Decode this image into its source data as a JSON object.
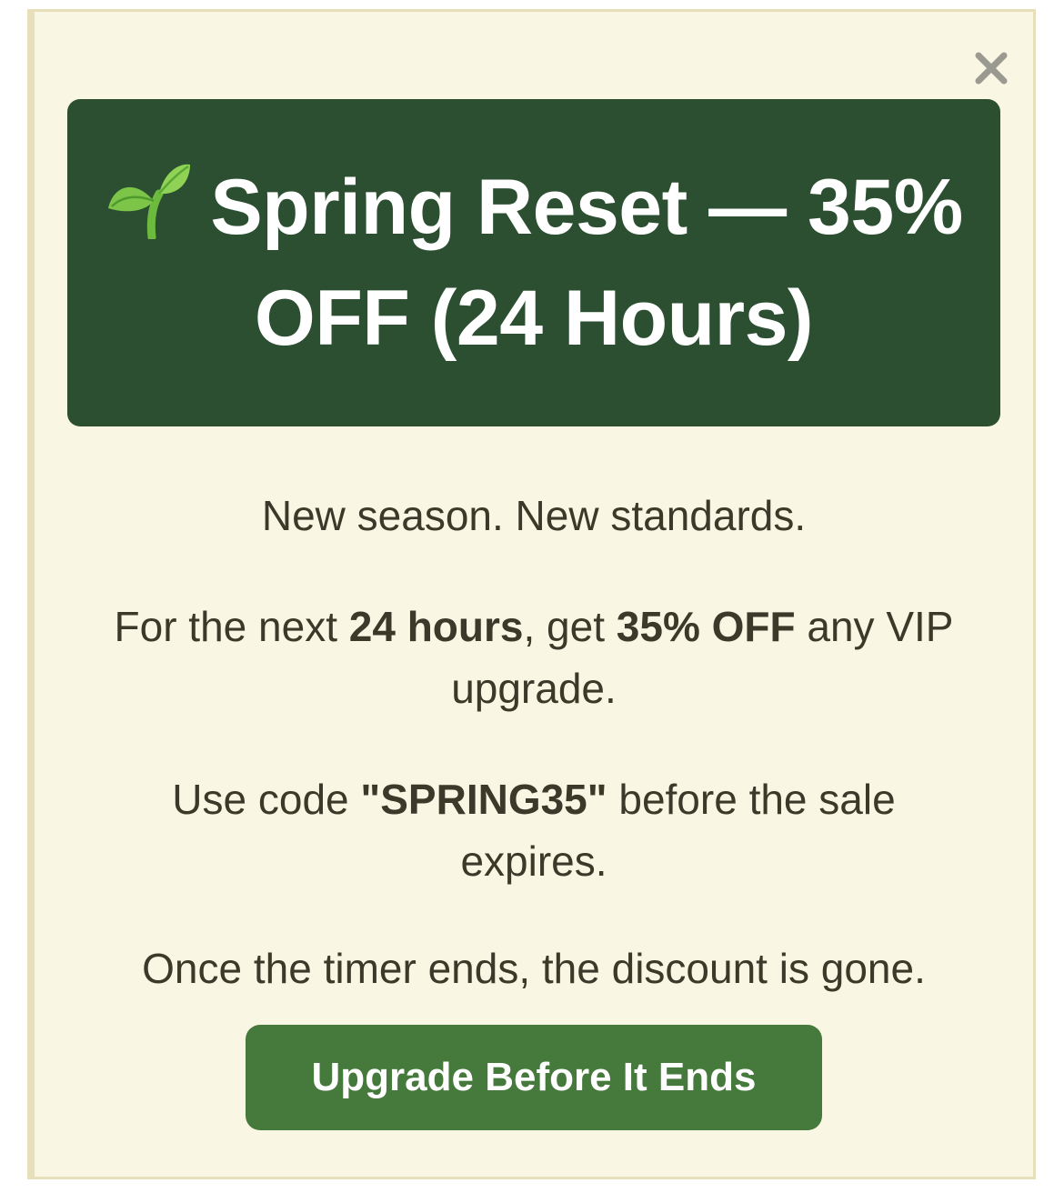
{
  "modal": {
    "close_icon": "close-icon",
    "banner": {
      "icon": "sprout-emoji",
      "title": "Spring Reset — 35% OFF (24 Hours)"
    },
    "tagline": "New season. New standards.",
    "offer": {
      "prefix": "For the next ",
      "duration": "24 hours",
      "middle": ", get ",
      "discount": "35% OFF",
      "suffix": " any VIP upgrade."
    },
    "code_line": {
      "prefix": "Use code ",
      "code": "\"SPRING35\"",
      "suffix": " before the sale expires."
    },
    "warning": "Once the timer ends, the discount is gone.",
    "cta_label": "Upgrade Before It Ends"
  },
  "colors": {
    "background": "#faf6e4",
    "border": "#e6dfb9",
    "banner": "#2b4f30",
    "cta": "#46793c",
    "text": "#3b3a2a"
  }
}
